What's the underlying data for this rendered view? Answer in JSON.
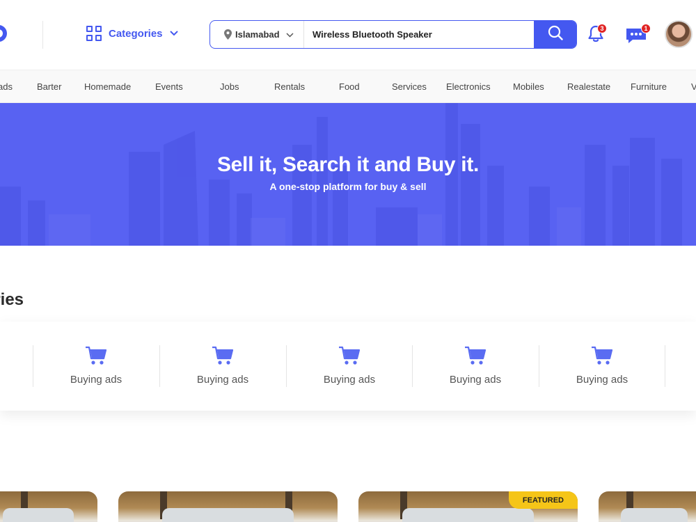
{
  "header": {
    "categories_label": "Categories",
    "location": "Islamabad",
    "search_value": "Wireless Bluetooth Speaker",
    "notifications_count": "3",
    "messages_count": "1"
  },
  "nav": {
    "items": [
      "ads",
      "Barter",
      "Homemade",
      "Events",
      "Jobs",
      "Rentals",
      "Food",
      "Services",
      "Electronics",
      "Mobiles",
      "Realestate",
      "Furniture",
      "V"
    ]
  },
  "hero": {
    "title": "Sell it, Search it and Buy it.",
    "subtitle": "A one-stop platform for buy & sell"
  },
  "categories_section": {
    "title": "gories",
    "items": [
      {
        "label": "Buying ads",
        "icon": "cart-icon"
      },
      {
        "label": "Buying ads",
        "icon": "cart-icon"
      },
      {
        "label": "Buying ads",
        "icon": "cart-icon"
      },
      {
        "label": "Buying ads",
        "icon": "cart-icon"
      },
      {
        "label": "Buying ads",
        "icon": "cart-icon"
      }
    ]
  },
  "listings": {
    "featured_label": "FEATURED"
  },
  "colors": {
    "accent": "#4458f0",
    "hero_bg": "#5862f2",
    "badge": "#e02424",
    "featured": "#f5c518"
  }
}
